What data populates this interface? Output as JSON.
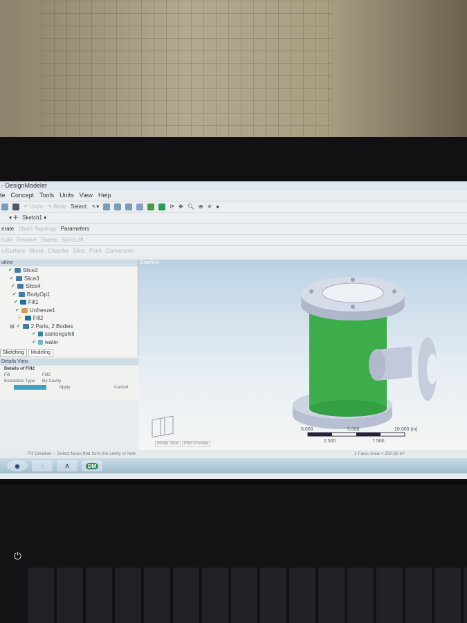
{
  "window": {
    "title": "- DesignModeler"
  },
  "menu": [
    "te",
    "Concept",
    "Tools",
    "Units",
    "View",
    "Help"
  ],
  "toolbar1": {
    "undo": "Undo",
    "redo": "Redo",
    "select": "Select:"
  },
  "toolbar2": {
    "sketch": "Sketch1"
  },
  "toolbar3": {
    "generate": "erate",
    "share_topology": "Share Topology",
    "parameters": "Parameters"
  },
  "toolbar4": [
    "rude",
    "Revolve",
    "Sweep",
    "Skin/Loft"
  ],
  "toolbar5": [
    "n/Surface",
    "Blend",
    "Chamfer",
    "Slice",
    "Point",
    "Conversion"
  ],
  "outline": {
    "title": "utline",
    "items": [
      {
        "label": "Slice2"
      },
      {
        "label": "Slice3"
      },
      {
        "label": "Slice4"
      },
      {
        "label": "BodyOp1"
      },
      {
        "label": "Fill1"
      },
      {
        "label": "Unfreeze1"
      },
      {
        "label": "Fill2"
      },
      {
        "label": "2 Parts, 2 Bodies"
      },
      {
        "label": "santongshiti"
      },
      {
        "label": "water"
      }
    ]
  },
  "tabs": [
    "Sketching",
    "Modeling"
  ],
  "details": {
    "title": "Details View",
    "header": "Details of Fill2",
    "rows": [
      {
        "k": "Fill",
        "v": "Fill2"
      },
      {
        "k": "Extraction Type",
        "v": "By Cavity"
      }
    ],
    "apply": "Apply",
    "cancel": "Cancel"
  },
  "graphics": {
    "title": "Graphics",
    "scale": {
      "labels_top": [
        "0.000",
        "5.000",
        "10.000 (in)"
      ],
      "labels_bottom": [
        "2.500",
        "7.500"
      ]
    },
    "view_tabs": [
      "Model View",
      "Print Preview"
    ]
  },
  "status": {
    "message": "Fill Creation -- Select faces that form the cavity or hole",
    "selection": "1 Face: Area = 250.58 in²"
  },
  "taskbar": {
    "dm": "DM"
  },
  "colors": {
    "body": "#3dac4a",
    "flange": "#c9cfe0"
  }
}
